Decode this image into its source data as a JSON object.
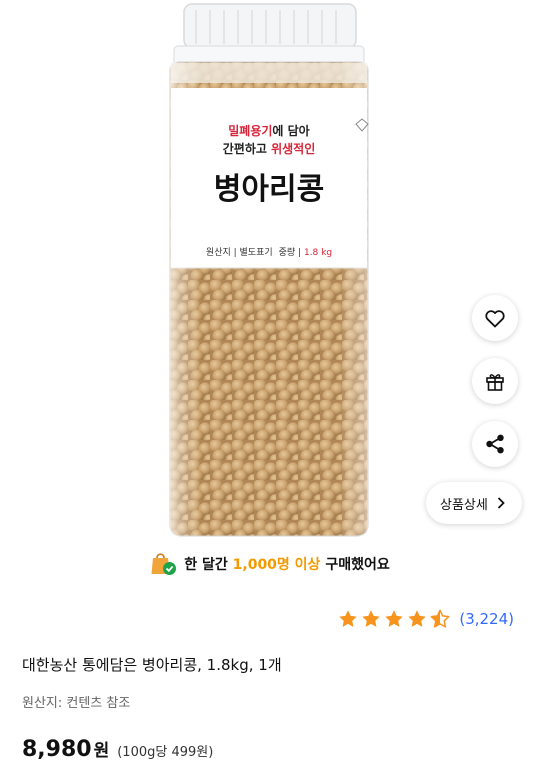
{
  "product_image": {
    "label_line1_red": "밀폐용기",
    "label_line1_rest": "에 담아",
    "label_line2_black": "간편하고 ",
    "label_line2_red": "위생적인",
    "label_main": "병아리콩",
    "label_info_left": "원산지 | 별도표기",
    "label_info_weight_label": "중량 | ",
    "label_info_weight_value": "1.8 kg"
  },
  "side_actions": {
    "like_icon": "heart-icon",
    "gift_icon": "gift-icon",
    "share_icon": "share-icon",
    "detail_label": "상품상세"
  },
  "banner": {
    "icon": "shopping-bag-check-icon",
    "prefix": "한 달간 ",
    "highlight": "1,000명 이상",
    "suffix": " 구매했어요"
  },
  "rating": {
    "stars": 4.5,
    "review_count": "(3,224)"
  },
  "product": {
    "title": "대한농산 통에담은 병아리콩, 1.8kg, 1개",
    "origin": "원산지: 컨텐츠 참조",
    "price": "8,980",
    "currency": "원",
    "unit_price": "(100g당 499원)"
  },
  "colors": {
    "star": "#f7941d",
    "accent_orange": "#f29a00",
    "review_blue": "#346aff",
    "label_red": "#d8253a"
  }
}
